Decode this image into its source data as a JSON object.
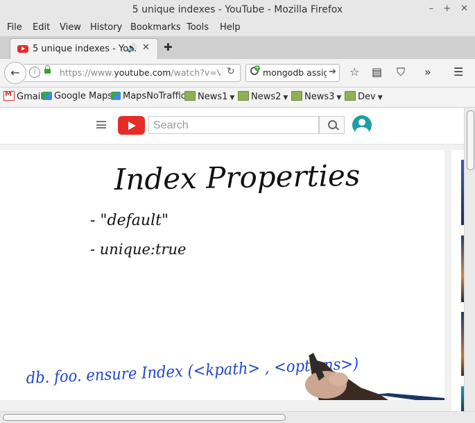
{
  "window": {
    "title": "5 unique indexes - YouTube - Mozilla Firefox",
    "controls": [
      "–",
      "+",
      "✕"
    ]
  },
  "menu": [
    "File",
    "Edit",
    "View",
    "History",
    "Bookmarks",
    "Tools",
    "Help"
  ],
  "tab": {
    "title": "5 unique indexes - Yo...",
    "close": "✕",
    "new_tab": "✚"
  },
  "nav": {
    "url_host_prefix": "https://www.",
    "url_host": "youtube.com",
    "url_path": "/watch?v=V",
    "search_text": "mongodb assign",
    "back_icon": "back-arrow-icon"
  },
  "bookmarks": [
    {
      "label": "Gmail",
      "icon": "gmail-icon",
      "menu": false
    },
    {
      "label": "Google Maps",
      "icon": "maps-icon",
      "menu": false
    },
    {
      "label": "MapsNoTraffic",
      "icon": "maps-icon",
      "menu": false
    },
    {
      "label": "News1",
      "icon": "folder-icon",
      "menu": true
    },
    {
      "label": "News2",
      "icon": "folder-icon",
      "menu": true
    },
    {
      "label": "News3",
      "icon": "folder-icon",
      "menu": true
    },
    {
      "label": "Dev",
      "icon": "folder-icon",
      "menu": true
    }
  ],
  "youtube": {
    "search_placeholder": "Search"
  },
  "video": {
    "heading": "Index Properties",
    "bullet1": "- \"default\"",
    "bullet2": "- unique:true",
    "command": "db. foo. ensure Index (<kpath> , <options>)"
  },
  "colors": {
    "brand_red": "#e52d27",
    "ink_black": "#111111",
    "ink_blue": "#1f47c9",
    "avatar_teal": "#1a9fa6"
  }
}
